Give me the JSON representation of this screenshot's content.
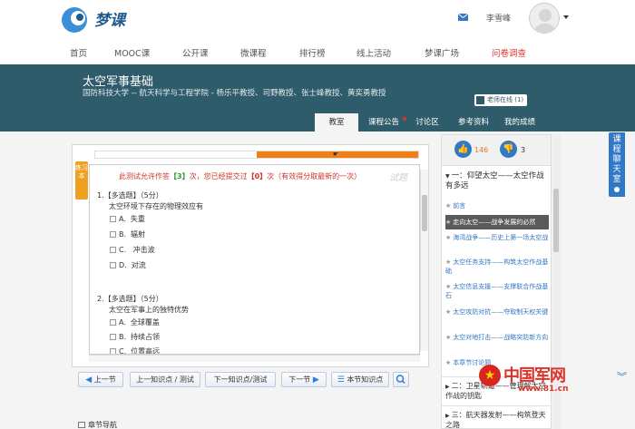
{
  "header": {
    "logo_text": "梦课",
    "user_name": "李雪峰"
  },
  "nav": {
    "items": [
      {
        "label": "首页"
      },
      {
        "label": "MOOC课"
      },
      {
        "label": "公开课"
      },
      {
        "label": "微课程"
      },
      {
        "label": "排行榜"
      },
      {
        "label": "线上活动"
      },
      {
        "label": "梦课广场"
      },
      {
        "label": "问卷调查"
      }
    ]
  },
  "course": {
    "title": "太空军事基础",
    "subtitle": "国防科技大学 -- 航天科学与工程学院 - 杨乐平教授、司野教授、张士峰教授、黄奕勇教授",
    "teacher_online": "老师在线 (1)",
    "tabs": [
      {
        "label": "教室"
      },
      {
        "label": "课程公告"
      },
      {
        "label": "讨论区"
      },
      {
        "label": "参考资料"
      },
      {
        "label": "我的成绩"
      }
    ]
  },
  "quiz": {
    "side_tag": "练习本",
    "watermark": "试题",
    "notice_prefix": "此测试允许作答",
    "notice_allowed": "【3】",
    "notice_mid": "次，您已经提交过",
    "notice_done": "【0】",
    "notice_suffix": "次（有效得分取最新的一次）",
    "progress_percent": 50,
    "questions": [
      {
        "head": "1.【多选题】（5分）",
        "stem": "太空环境下存在的物理效应有",
        "options": [
          {
            "letter": "A.",
            "text": "失重"
          },
          {
            "letter": "B.",
            "text": "辐射"
          },
          {
            "letter": "C.",
            "text": " 冲击波"
          },
          {
            "letter": "D.",
            "text": "对流"
          }
        ]
      },
      {
        "head": "2.【多选题】（5分）",
        "stem": "太空在军事上的独特优势",
        "options": [
          {
            "letter": "A.",
            "text": "全球覆盖"
          },
          {
            "letter": "B.",
            "text": "持续占领"
          },
          {
            "letter": "C.",
            "text": "位置高远"
          }
        ]
      }
    ]
  },
  "controls": {
    "prev_section": "上一节",
    "prev_point": "上一知识点 / 测试",
    "next_point": "下一知识点/测试",
    "next_section": "下一节",
    "section_points": "本节知识点",
    "chapter_nav": "章节导航"
  },
  "panel": {
    "likes": "146",
    "dislikes": "3",
    "chapter1_title": "一：仰望太空——太空作战有多远",
    "lessons": [
      {
        "text": "前言"
      },
      {
        "text": "走向太空——战争发展的必然"
      },
      {
        "text": "海湾战争——历史上第一场太空战"
      },
      {
        "text": "太空任务支持——构筑太空作战基础"
      },
      {
        "text": "太空信息支援——支撑联合作战基石"
      },
      {
        "text": "太空攻防对抗——夺取制天权关键"
      },
      {
        "text": "太空对地打击——战略突防新方向"
      },
      {
        "text": "本章节讨论题"
      }
    ],
    "chapter2_title": "二：卫星轨道——管理解太空作战的钥匙",
    "chapter3_title": "三：航天器发射——构筑登天之路"
  },
  "chat_tab": "课程聊天室",
  "watermark": {
    "name": "中国军网",
    "url": "www.81.cn"
  },
  "colors": {
    "banner": "#2f5c6a",
    "accent_blue": "#3178c6",
    "progress_orange": "#f07f14",
    "notice_red": "#d0342c"
  }
}
